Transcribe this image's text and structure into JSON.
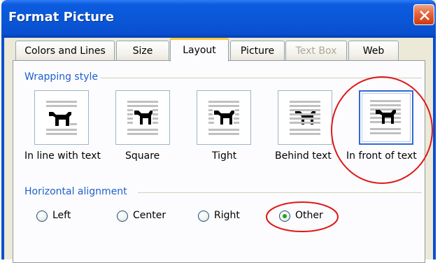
{
  "window": {
    "title": "Format Picture"
  },
  "tabs": [
    {
      "label": "Colors and Lines",
      "state": "normal"
    },
    {
      "label": "Size",
      "state": "normal"
    },
    {
      "label": "Layout",
      "state": "active"
    },
    {
      "label": "Picture",
      "state": "normal"
    },
    {
      "label": "Text Box",
      "state": "disabled"
    },
    {
      "label": "Web",
      "state": "normal"
    }
  ],
  "wrapping": {
    "heading": "Wrapping style",
    "options": [
      {
        "label": "In line with text",
        "icon": "inline-with-text-icon"
      },
      {
        "label": "Square",
        "icon": "square-wrap-icon"
      },
      {
        "label": "Tight",
        "icon": "tight-wrap-icon"
      },
      {
        "label": "Behind text",
        "icon": "behind-text-icon"
      },
      {
        "label": "In front of text",
        "icon": "in-front-of-text-icon"
      }
    ],
    "selected": "In front of text"
  },
  "alignment": {
    "heading": "Horizontal alignment",
    "options": [
      "Left",
      "Center",
      "Right",
      "Other"
    ],
    "selected": "Other"
  },
  "colors": {
    "titlebar": "#0a57d8",
    "accent_heading": "#1f5fcc",
    "annotation": "#e01818",
    "radio_dot": "#21a121"
  }
}
